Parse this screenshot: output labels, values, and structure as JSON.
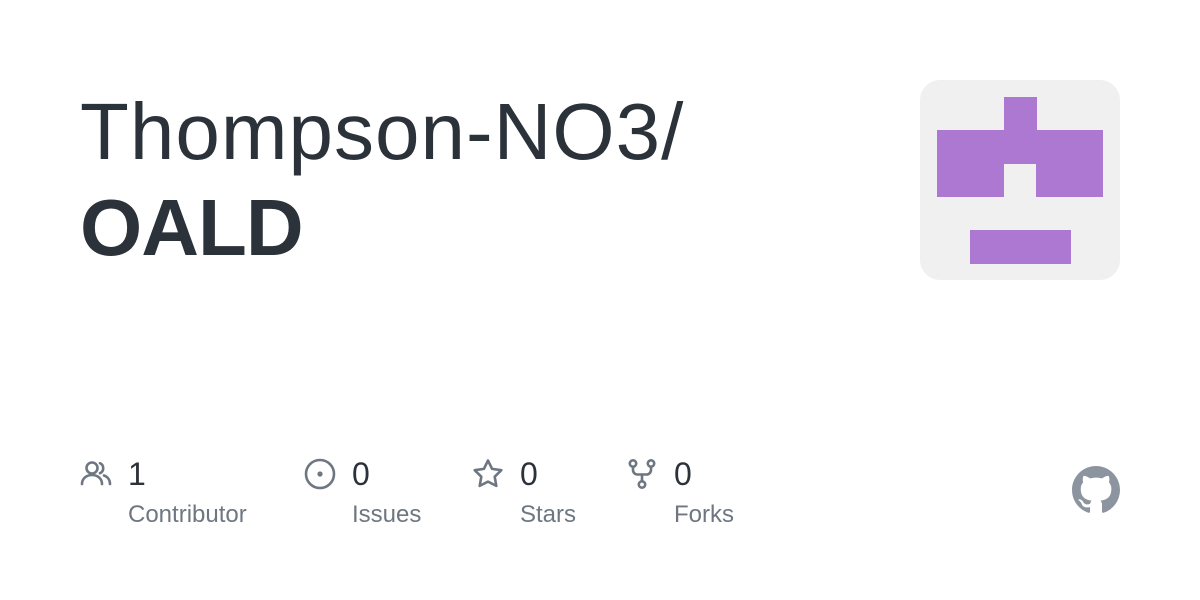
{
  "repo_card": {
    "owner": "Thompson-NO3/",
    "name": "OALD",
    "avatar": {
      "background": "#f0f0f0",
      "color": "#ad78d1"
    },
    "stats": [
      {
        "icon": "people-icon",
        "value": "1",
        "label": "Contributor"
      },
      {
        "icon": "issue-icon",
        "value": "0",
        "label": "Issues"
      },
      {
        "icon": "star-icon",
        "value": "0",
        "label": "Stars"
      },
      {
        "icon": "fork-icon",
        "value": "0",
        "label": "Forks"
      }
    ],
    "logo_icon": "github-mark-icon",
    "colors": {
      "text": "#2c323a",
      "muted": "#6e7781",
      "logo": "#8c959f"
    }
  }
}
